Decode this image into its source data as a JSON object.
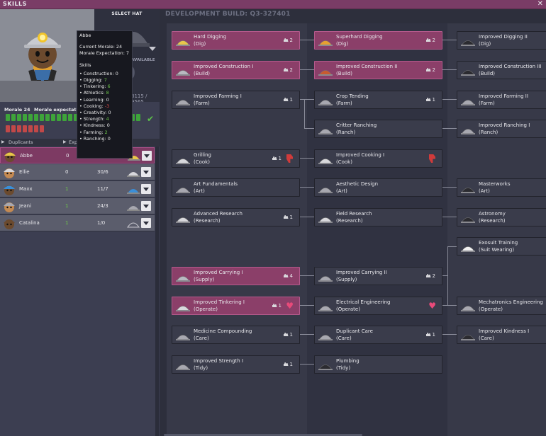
{
  "window": {
    "title": "SKILLS",
    "close": "✕"
  },
  "build": "DEVELOPMENT BUILD: Q3-327401",
  "hat_panel": {
    "label": "SELECT HAT",
    "skill_points": "SKILL POINTS AVAILABLE",
    "skill_points_value": "0",
    "xp": "8115 / 9565"
  },
  "tooltip": {
    "name": "Abbe",
    "morale": "Current Morale: 24",
    "expectation": "Morale Expectation: 7",
    "skills_header": "Skills",
    "attrs": [
      {
        "label": "• Construction: ",
        "value": "0",
        "cls": ""
      },
      {
        "label": "• Digging: ",
        "value": "7",
        "cls": "g"
      },
      {
        "label": "• Tinkering: ",
        "value": "6",
        "cls": "g"
      },
      {
        "label": "• Athletics: ",
        "value": "8",
        "cls": "g"
      },
      {
        "label": "• Learning: ",
        "value": "0",
        "cls": ""
      },
      {
        "label": "• Cooking: ",
        "value": "-3",
        "cls": "r"
      },
      {
        "label": "• Creativity: ",
        "value": "0",
        "cls": ""
      },
      {
        "label": "• Strength: ",
        "value": "4",
        "cls": "g"
      },
      {
        "label": "• Kindness: ",
        "value": "0",
        "cls": ""
      },
      {
        "label": "• Farming: ",
        "value": "2",
        "cls": "g"
      },
      {
        "label": "• Ranching: ",
        "value": "0",
        "cls": ""
      }
    ]
  },
  "morale": {
    "label": "Morale",
    "value": "24",
    "expectation_label": "Morale expectation",
    "green_segments": 24,
    "red_segments": 7
  },
  "dup_header": {
    "duplicants": "Duplicants",
    "exp": "Exp",
    "hat": "at"
  },
  "duplicants": [
    {
      "name": "Abbe",
      "points": "0",
      "ratio": "24/7",
      "points_color": "#e8e8ec",
      "selected": true,
      "hat": "miner"
    },
    {
      "name": "Ellie",
      "points": "0",
      "ratio": "30/6",
      "points_color": "#e8e8ec",
      "selected": false,
      "hat": "builder"
    },
    {
      "name": "Maxx",
      "points": "1",
      "ratio": "11/7",
      "points_color": "#6ec94a",
      "selected": false,
      "hat": "blue"
    },
    {
      "name": "Jeani",
      "points": "1",
      "ratio": "24/3",
      "points_color": "#6ec94a",
      "selected": false,
      "hat": "grey"
    },
    {
      "name": "Catalina",
      "points": "1",
      "ratio": "1/0",
      "points_color": "#6ec94a",
      "selected": false,
      "hat": "none"
    }
  ],
  "skills": [
    {
      "id": "hard-digging",
      "name": "Hard Digging",
      "group": "(Dig)",
      "col": 0,
      "row": 0,
      "on": true,
      "pts": "2",
      "badge": "pts",
      "icon": "#e8c64a"
    },
    {
      "id": "superhard-digging",
      "name": "Superhard Digging",
      "group": "(Dig)",
      "col": 1,
      "row": 0,
      "on": true,
      "pts": "2",
      "badge": "pts",
      "icon": "#e8a030"
    },
    {
      "id": "improved-digging-ii",
      "name": "Improved Digging II",
      "group": "(Dig)",
      "col": 2,
      "row": 0,
      "on": false,
      "pts": "",
      "badge": "",
      "icon": "#2b2b30"
    },
    {
      "id": "improved-construction-i",
      "name": "Improved Construction I",
      "group": "(Build)",
      "col": 0,
      "row": 1,
      "on": true,
      "pts": "2",
      "badge": "pts",
      "icon": "#b8b8c0"
    },
    {
      "id": "improved-construction-ii",
      "name": "Improved Construction II",
      "group": "(Build)",
      "col": 1,
      "row": 1,
      "on": true,
      "pts": "2",
      "badge": "pts",
      "icon": "#c85a30"
    },
    {
      "id": "improved-construction-iii",
      "name": "Improved Construction III",
      "group": "(Build)",
      "col": 2,
      "row": 1,
      "on": false,
      "pts": "",
      "badge": "",
      "icon": "#2b2b30"
    },
    {
      "id": "improved-farming-i",
      "name": "Improved Farming I",
      "group": "(Farm)",
      "col": 0,
      "row": 2,
      "on": false,
      "pts": "1",
      "badge": "pts",
      "icon": "#a8a8b0"
    },
    {
      "id": "crop-tending",
      "name": "Crop Tending",
      "group": "(Farm)",
      "col": 1,
      "row": 2,
      "on": false,
      "pts": "1",
      "badge": "pts",
      "icon": "#a8a8b0"
    },
    {
      "id": "improved-farming-ii",
      "name": "Improved Farming II",
      "group": "(Farm)",
      "col": 2,
      "row": 2,
      "on": false,
      "pts": "",
      "badge": "",
      "icon": "#a8a8b0"
    },
    {
      "id": "critter-ranching",
      "name": "Critter Ranching",
      "group": "(Ranch)",
      "col": 1,
      "row": 3,
      "on": false,
      "pts": "",
      "badge": "",
      "icon": "#a8a8b0"
    },
    {
      "id": "improved-ranching-i",
      "name": "Improved Ranching I",
      "group": "(Ranch)",
      "col": 2,
      "row": 3,
      "on": false,
      "pts": "",
      "badge": "",
      "icon": "#a8a8b0"
    },
    {
      "id": "grilling",
      "name": "Grilling",
      "group": "(Cook)",
      "col": 0,
      "row": 4,
      "on": false,
      "pts": "1",
      "badge": "pts",
      "thumb": true,
      "icon": "#d8d8dc"
    },
    {
      "id": "improved-cooking-i",
      "name": "Improved Cooking I",
      "group": "(Cook)",
      "col": 1,
      "row": 4,
      "on": false,
      "pts": "",
      "badge": "",
      "thumb": true,
      "icon": "#d8d8dc"
    },
    {
      "id": "art-fundamentals",
      "name": "Art Fundamentals",
      "group": "(Art)",
      "col": 0,
      "row": 5,
      "on": false,
      "pts": "",
      "badge": "",
      "icon": "#a8a8b0"
    },
    {
      "id": "aesthetic-design",
      "name": "Aesthetic Design",
      "group": "(Art)",
      "col": 1,
      "row": 5,
      "on": false,
      "pts": "",
      "badge": "",
      "icon": "#a8a8b0"
    },
    {
      "id": "masterworks",
      "name": "Masterworks",
      "group": "(Art)",
      "col": 2,
      "row": 5,
      "on": false,
      "pts": "",
      "badge": "",
      "icon": "#2b2b30"
    },
    {
      "id": "advanced-research",
      "name": "Advanced Research",
      "group": "(Research)",
      "col": 0,
      "row": 6,
      "on": false,
      "pts": "1",
      "badge": "pts",
      "icon": "#d8d8dc"
    },
    {
      "id": "field-research",
      "name": "Field Research",
      "group": "(Research)",
      "col": 1,
      "row": 6,
      "on": false,
      "pts": "",
      "badge": "",
      "icon": "#d8d8dc"
    },
    {
      "id": "astronomy",
      "name": "Astronomy",
      "group": "(Research)",
      "col": 2,
      "row": 6,
      "on": false,
      "pts": "",
      "badge": "",
      "icon": "#2b2b30"
    },
    {
      "id": "exosuit-training",
      "name": "Exosuit Training",
      "group": "(Suit Wearing)",
      "col": 2,
      "row": 7,
      "on": false,
      "pts": "",
      "badge": "",
      "icon": "#f0f0f0"
    },
    {
      "id": "improved-carrying-i",
      "name": "Improved Carrying I",
      "group": "(Supply)",
      "col": 0,
      "row": 8,
      "on": true,
      "pts": "4",
      "badge": "pts",
      "icon": "#b8b8c0"
    },
    {
      "id": "improved-carrying-ii",
      "name": "Improved Carrying II",
      "group": "(Supply)",
      "col": 1,
      "row": 8,
      "on": false,
      "pts": "2",
      "badge": "pts",
      "icon": "#a8a8b0"
    },
    {
      "id": "improved-tinkering-i",
      "name": "Improved Tinkering I",
      "group": "(Operate)",
      "col": 0,
      "row": 9,
      "on": true,
      "pts": "1",
      "badge": "pts",
      "fav": true,
      "icon": "#d8d8dc"
    },
    {
      "id": "electrical-engineering",
      "name": "Electrical Engineering",
      "group": "(Operate)",
      "col": 1,
      "row": 9,
      "on": false,
      "pts": "",
      "badge": "",
      "fav": true,
      "icon": "#a8a8b0"
    },
    {
      "id": "mechatronics-engineering",
      "name": "Mechatronics Engineering",
      "group": "(Operate)",
      "col": 2,
      "row": 9,
      "on": false,
      "pts": "",
      "badge": "",
      "icon": "#a8a8b0"
    },
    {
      "id": "medicine-compounding",
      "name": "Medicine Compounding",
      "group": "(Care)",
      "col": 0,
      "row": 10,
      "on": false,
      "pts": "1",
      "badge": "pts",
      "icon": "#a8a8b0"
    },
    {
      "id": "duplicant-care",
      "name": "Duplicant Care",
      "group": "(Care)",
      "col": 1,
      "row": 10,
      "on": false,
      "pts": "1",
      "badge": "pts",
      "icon": "#a8a8b0"
    },
    {
      "id": "improved-kindness-i",
      "name": "Improved Kindness I",
      "group": "(Care)",
      "col": 2,
      "row": 10,
      "on": false,
      "pts": "",
      "badge": "",
      "icon": "#2b2b30"
    },
    {
      "id": "improved-strength-i",
      "name": "Improved Strength I",
      "group": "(Tidy)",
      "col": 0,
      "row": 11,
      "on": false,
      "pts": "1",
      "badge": "pts",
      "icon": "#a8a8b0"
    },
    {
      "id": "plumbing",
      "name": "Plumbing",
      "group": "(Tidy)",
      "col": 1,
      "row": 11,
      "on": false,
      "pts": "",
      "badge": "",
      "icon": "#2b2b30"
    }
  ]
}
